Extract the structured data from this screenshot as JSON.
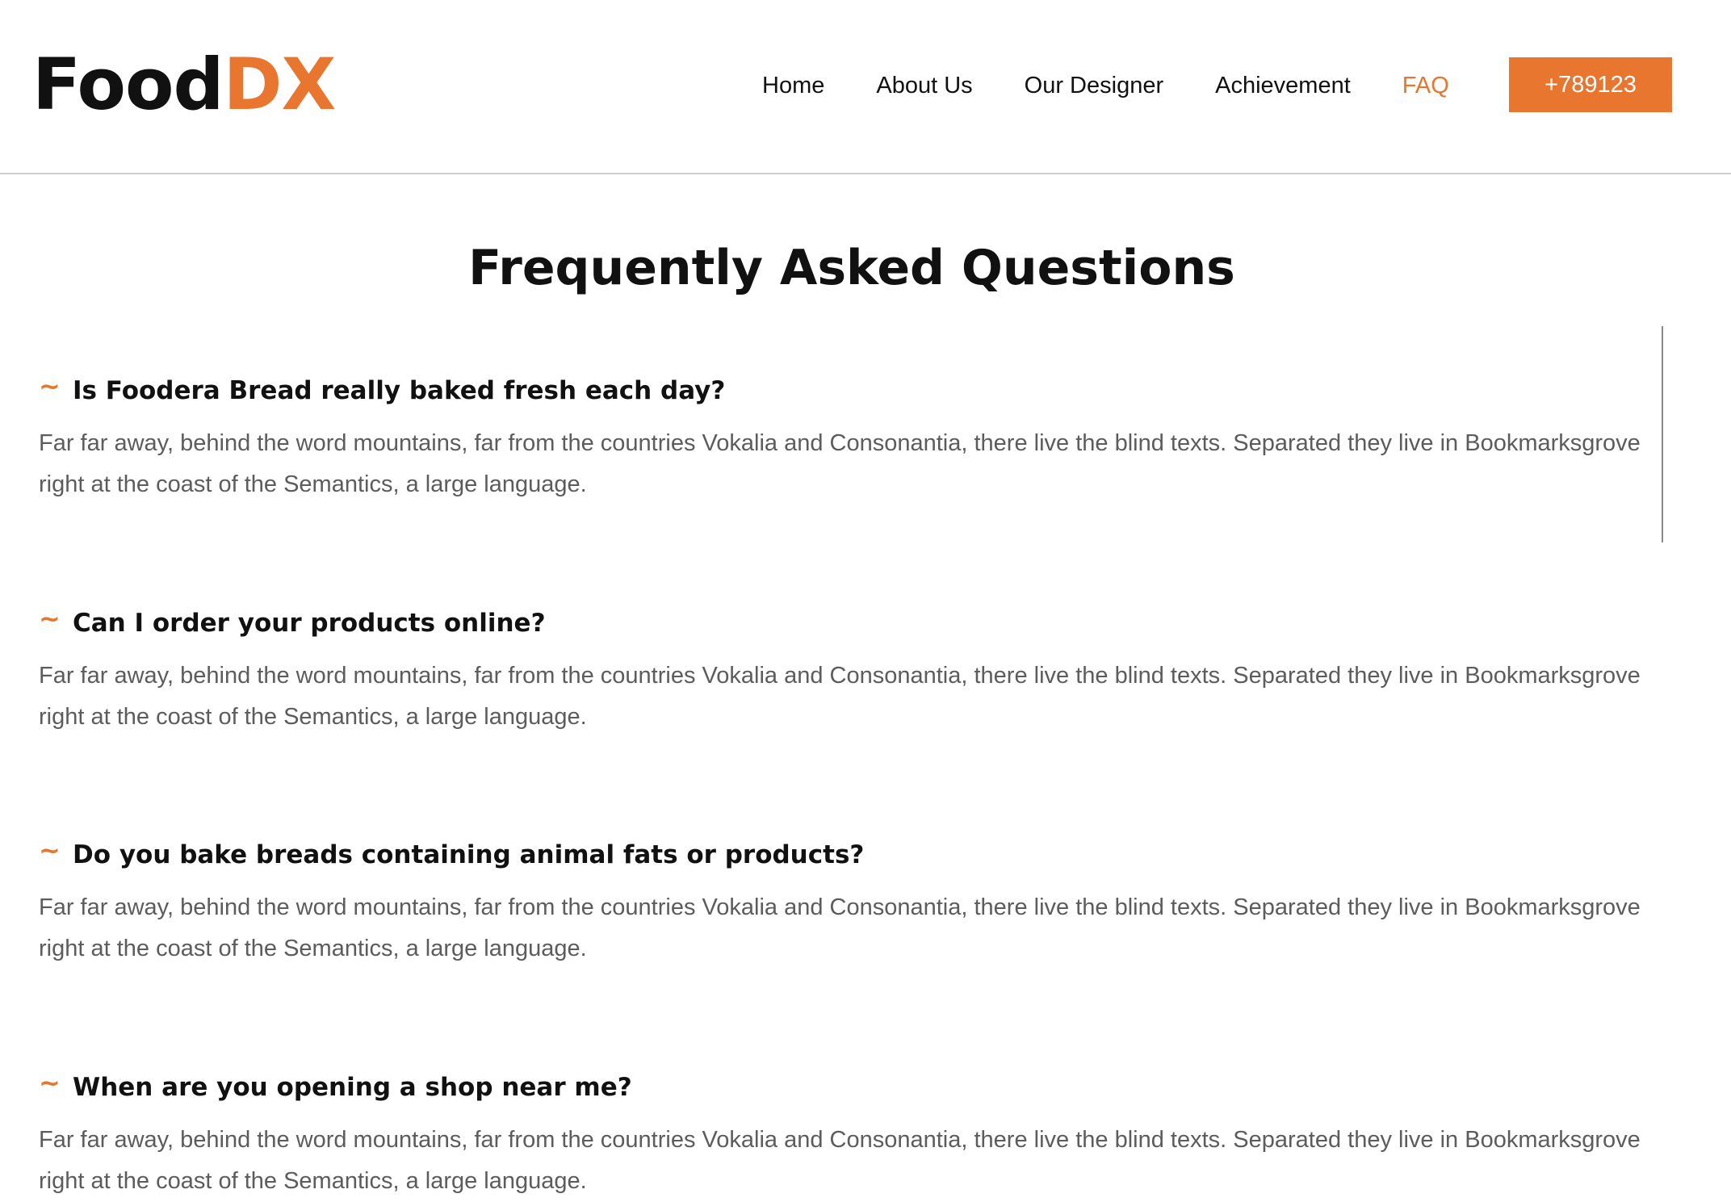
{
  "header": {
    "logo": {
      "part1": "Food",
      "part2": "DX"
    },
    "nav": [
      {
        "label": "Home"
      },
      {
        "label": "About Us"
      },
      {
        "label": "Our Designer"
      },
      {
        "label": "Achievement"
      },
      {
        "label": "FAQ",
        "active": true
      }
    ],
    "phone_label": "+789123"
  },
  "colors": {
    "accent": "#e8762f",
    "text_dark": "#111111",
    "text_body": "#5c5c5c"
  },
  "faq": {
    "title": "Frequently Asked Questions",
    "bullet_icon": "tilde-icon",
    "items": [
      {
        "question": "Is Foodera Bread really baked fresh each day?",
        "answer": "Far far away, behind the word mountains, far from the countries Vokalia and Consonantia, there live the blind texts. Separated they live in Bookmarksgrove right at the coast of the Semantics, a large language."
      },
      {
        "question": "Can I order your products online?",
        "answer": "Far far away, behind the word mountains, far from the countries Vokalia and Consonantia, there live the blind texts. Separated they live in Bookmarksgrove right at the coast of the Semantics, a large language."
      },
      {
        "question": "Do you bake breads containing animal fats or products?",
        "answer": "Far far away, behind the word mountains, far from the countries Vokalia and Consonantia, there live the blind texts. Separated they live in Bookmarksgrove right at the coast of the Semantics, a large language."
      },
      {
        "question": "When are you opening a shop near me?",
        "answer": "Far far away, behind the word mountains, far from the countries Vokalia and Consonantia, there live the blind texts. Separated they live in Bookmarksgrove right at the coast of the Semantics, a large language."
      }
    ]
  }
}
